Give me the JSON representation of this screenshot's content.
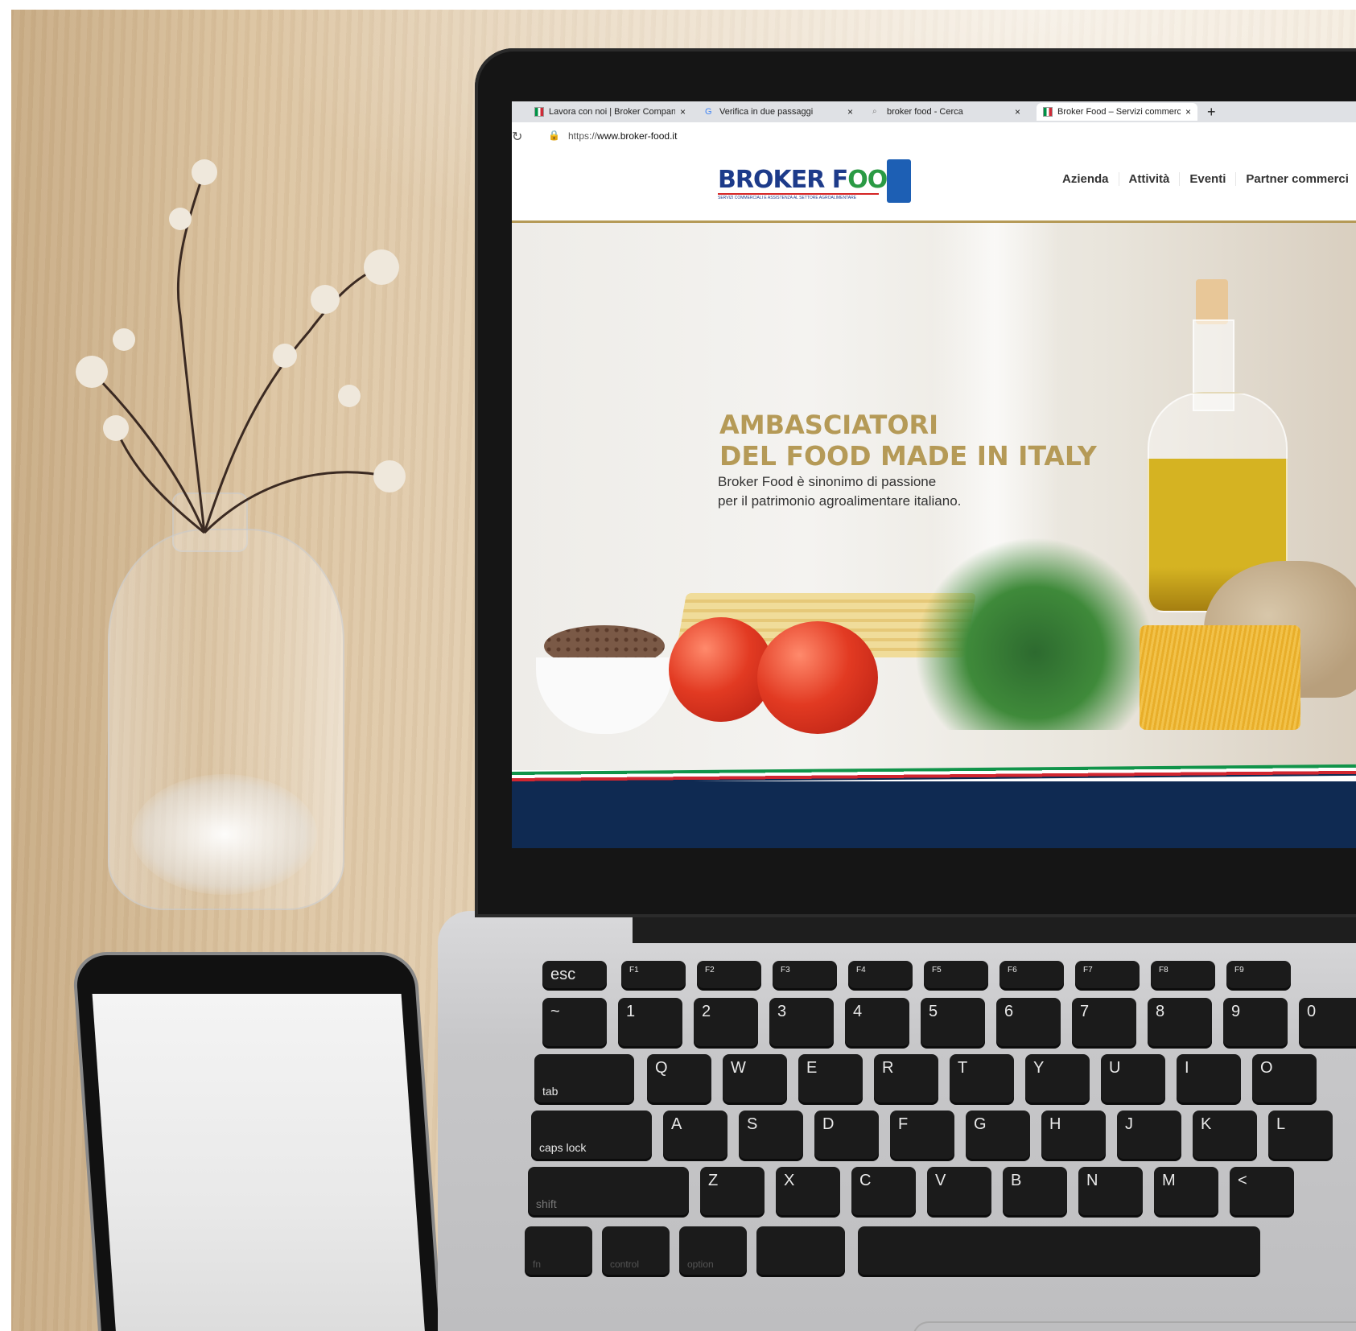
{
  "browser": {
    "tabs": [
      {
        "title": "Lavora con noi | Broker Company",
        "favicon": "italy-flag-icon",
        "close": "×"
      },
      {
        "title": "Verifica in due passaggi",
        "favicon": "google-icon",
        "close": "×"
      },
      {
        "title": "broker food - Cerca",
        "favicon": "search-icon",
        "close": "×"
      },
      {
        "title": "Broker Food – Servizi commerciali",
        "favicon": "italy-flag-icon",
        "close": "×"
      }
    ],
    "new_tab": "+",
    "url_protocol": "https://",
    "url_host": "www.broker-food.it"
  },
  "site": {
    "logo": {
      "broker": "BROKER F",
      "oo": "OO",
      "d": "D",
      "tagline": "SERVIZI COMMERCIALI E ASSISTENZA AL SETTORE AGROALIMENTARE"
    },
    "nav": [
      "Azienda",
      "Attività",
      "Eventi",
      "Partner commerci"
    ],
    "hero": {
      "title_line1": "AMBASCIATORI",
      "title_line2": "DEL FOOD MADE IN ITALY",
      "subtitle_line1": "Broker Food è sinonimo di passione",
      "subtitle_line2": "per il patrimonio agroalimentare italiano."
    }
  },
  "keyboard": {
    "row1": [
      "esc",
      "F1",
      "F2",
      "F3",
      "F4",
      "F5",
      "F6",
      "F7",
      "F8",
      "F9"
    ],
    "row2": [
      "~",
      "1",
      "2",
      "3",
      "4",
      "5",
      "6",
      "7",
      "8",
      "9",
      "0"
    ],
    "row3": [
      "tab",
      "Q",
      "W",
      "E",
      "R",
      "T",
      "Y",
      "U",
      "I",
      "O"
    ],
    "row4": [
      "caps lock",
      "A",
      "S",
      "D",
      "F",
      "G",
      "H",
      "J",
      "K",
      "L"
    ],
    "row5": [
      "shift",
      "Z",
      "X",
      "C",
      "V",
      "B",
      "N",
      "M",
      "<"
    ],
    "row6": [
      "fn",
      "control",
      "option",
      ""
    ]
  },
  "colors": {
    "gold": "#b59a57",
    "navy": "#0f2a52",
    "logo_blue": "#1d3b8a",
    "logo_green": "#2a9a44",
    "logo_red": "#d42424"
  }
}
